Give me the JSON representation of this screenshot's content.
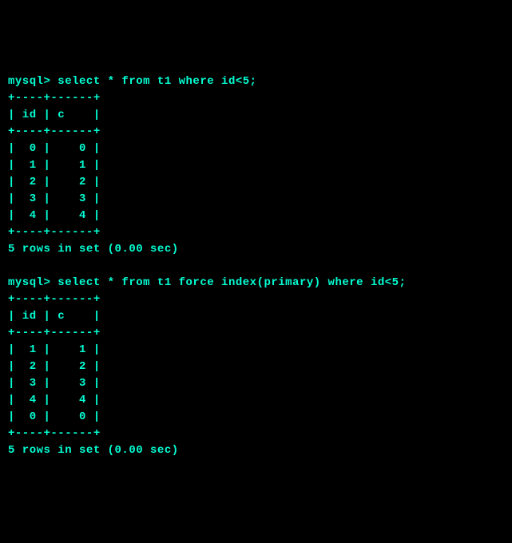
{
  "session": {
    "prompt": "mysql>",
    "queries": [
      {
        "sql": "select * from t1 where id<5;",
        "columns": [
          "id",
          "c"
        ],
        "rows": [
          {
            "id": 0,
            "c": 0
          },
          {
            "id": 1,
            "c": 1
          },
          {
            "id": 2,
            "c": 2
          },
          {
            "id": 3,
            "c": 3
          },
          {
            "id": 4,
            "c": 4
          }
        ],
        "status": "5 rows in set (0.00 sec)"
      },
      {
        "sql": "select * from t1 force index(primary) where id<5;",
        "columns": [
          "id",
          "c"
        ],
        "rows": [
          {
            "id": 1,
            "c": 1
          },
          {
            "id": 2,
            "c": 2
          },
          {
            "id": 3,
            "c": 3
          },
          {
            "id": 4,
            "c": 4
          },
          {
            "id": 0,
            "c": 0
          }
        ],
        "status": "5 rows in set (0.00 sec)"
      }
    ],
    "layout": {
      "id_width": 4,
      "c_width": 6
    }
  }
}
